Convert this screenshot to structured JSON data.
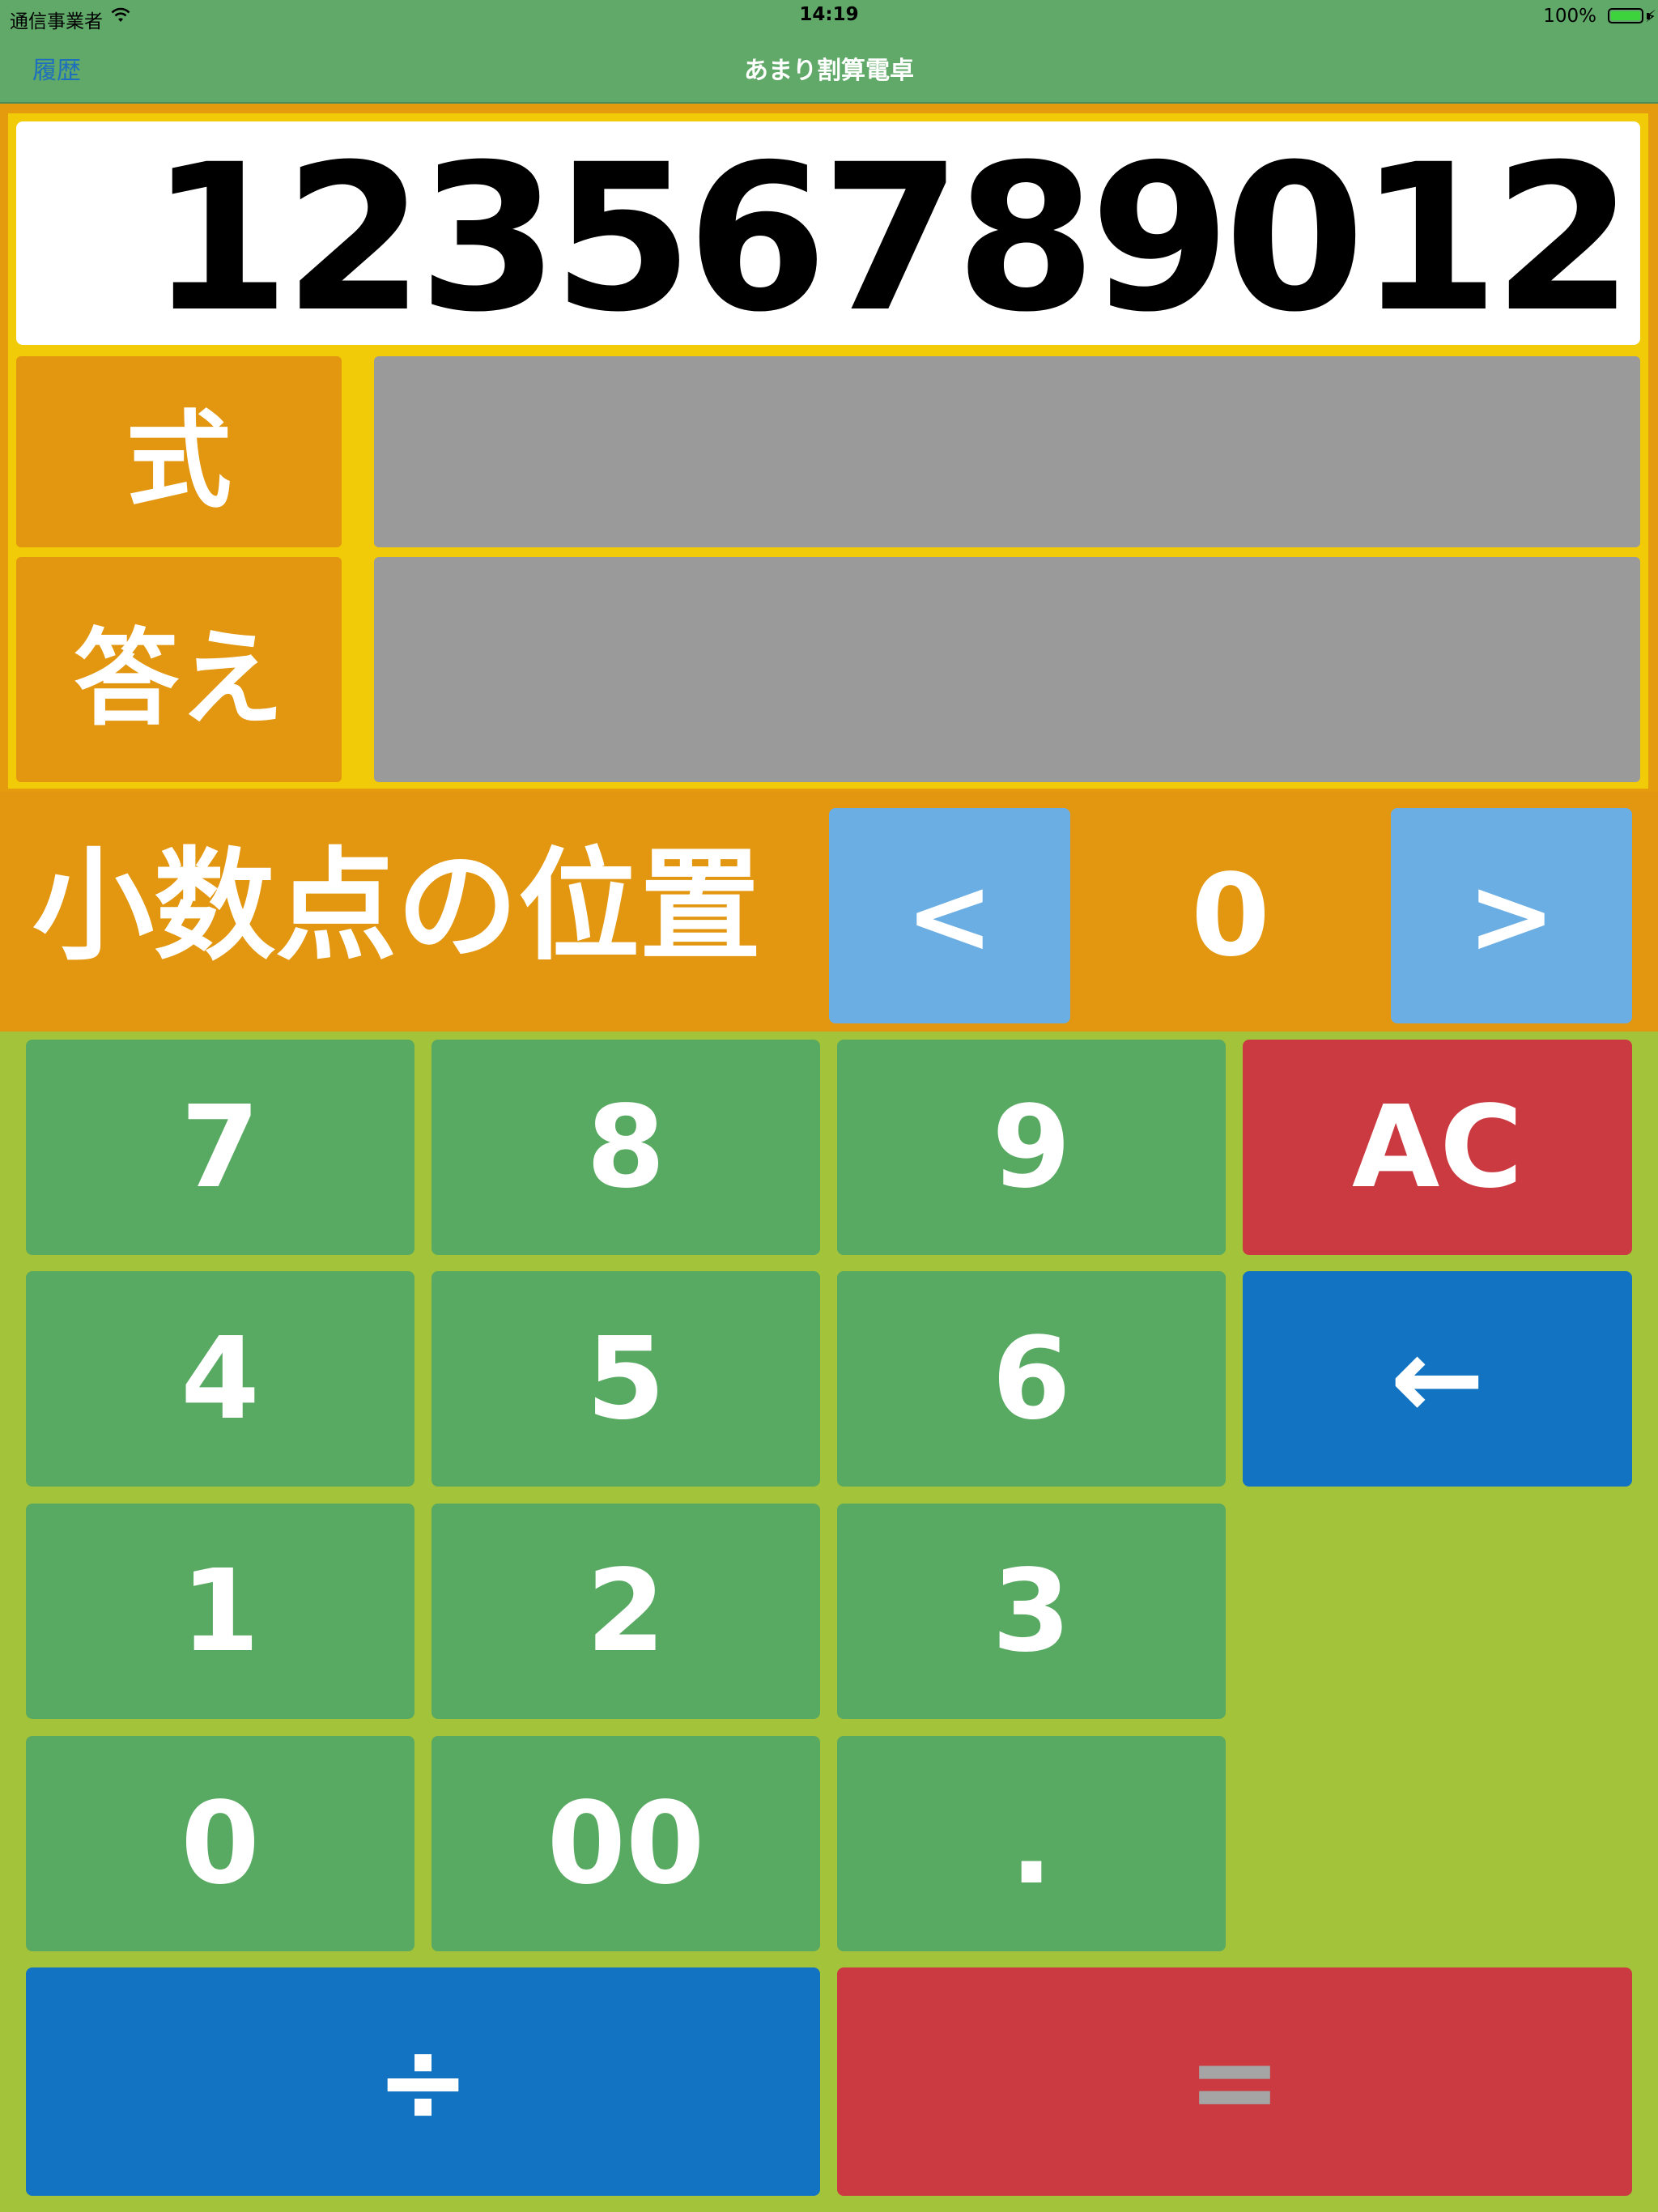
{
  "status_bar": {
    "carrier": "通信事業者",
    "time": "14:19",
    "battery": "100%"
  },
  "nav": {
    "history_label": "履歴",
    "title": "あまり割算電卓"
  },
  "display": {
    "value": "12356789012"
  },
  "rows": {
    "expression_label": "式",
    "expression_value": "",
    "answer_label": "答え",
    "answer_value": ""
  },
  "decimal": {
    "label": "小数点の位置",
    "left_label": "<",
    "value": "0",
    "right_label": ">"
  },
  "keypad": {
    "k7": "7",
    "k8": "8",
    "k9": "9",
    "ac": "AC",
    "k4": "4",
    "k5": "5",
    "k6": "6",
    "backspace": "←",
    "k1": "1",
    "k2": "2",
    "k3": "3",
    "k0": "0",
    "k00": "00",
    "dot": ".",
    "divide": "÷",
    "equals": "="
  },
  "colors": {
    "bar_green": "#60a968",
    "panel_orange": "#e3960f",
    "frame_yellow": "#f1cb08",
    "key_green": "#58a962",
    "key_red": "#cb3a40",
    "key_blue": "#1173c2",
    "arrow_blue": "#6aaee4",
    "background_lime": "#a2c33a"
  }
}
